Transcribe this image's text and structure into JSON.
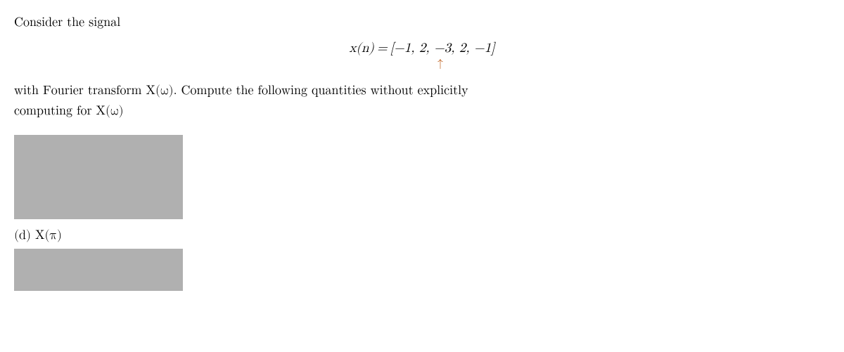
{
  "intro": {
    "text": "Consider the signal"
  },
  "equation": {
    "lhs": "x(n)",
    "equals": "=",
    "rhs": "[−1, 2, −3, 2, −1]",
    "arrow": "↑",
    "arrow_color": "#b8520a"
  },
  "description": {
    "line1": "with Fourier transform X(ω).  Compute the following quantities without explicitly",
    "line2": "computing for X(ω)"
  },
  "part_d": {
    "label": "(d)  X(π)"
  }
}
